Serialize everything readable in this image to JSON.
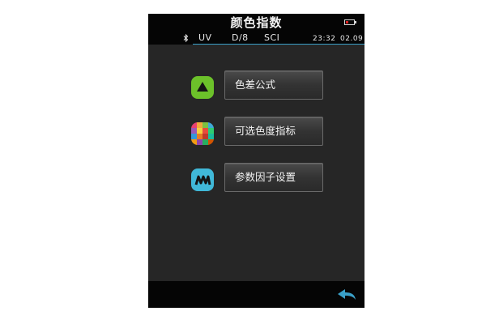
{
  "header": {
    "title": "颜色指数",
    "battery_icon": "battery-low-icon"
  },
  "status": {
    "bluetooth_icon": "bluetooth-icon",
    "light_source": "UV",
    "geometry": "D/8",
    "mode": "SCI",
    "time": "23:32",
    "date": "02.09"
  },
  "menu": {
    "items": [
      {
        "label": "色差公式",
        "icon": "triangle-icon",
        "icon_color": "#6cc12a"
      },
      {
        "label": "可选色度指标",
        "icon": "color-mosaic-icon"
      },
      {
        "label": "参数因子设置",
        "icon": "parameters-icon",
        "icon_color": "#40b8d8"
      }
    ]
  },
  "footer": {
    "back_icon": "back-arrow-icon",
    "accent_color": "#3aa0c8"
  }
}
